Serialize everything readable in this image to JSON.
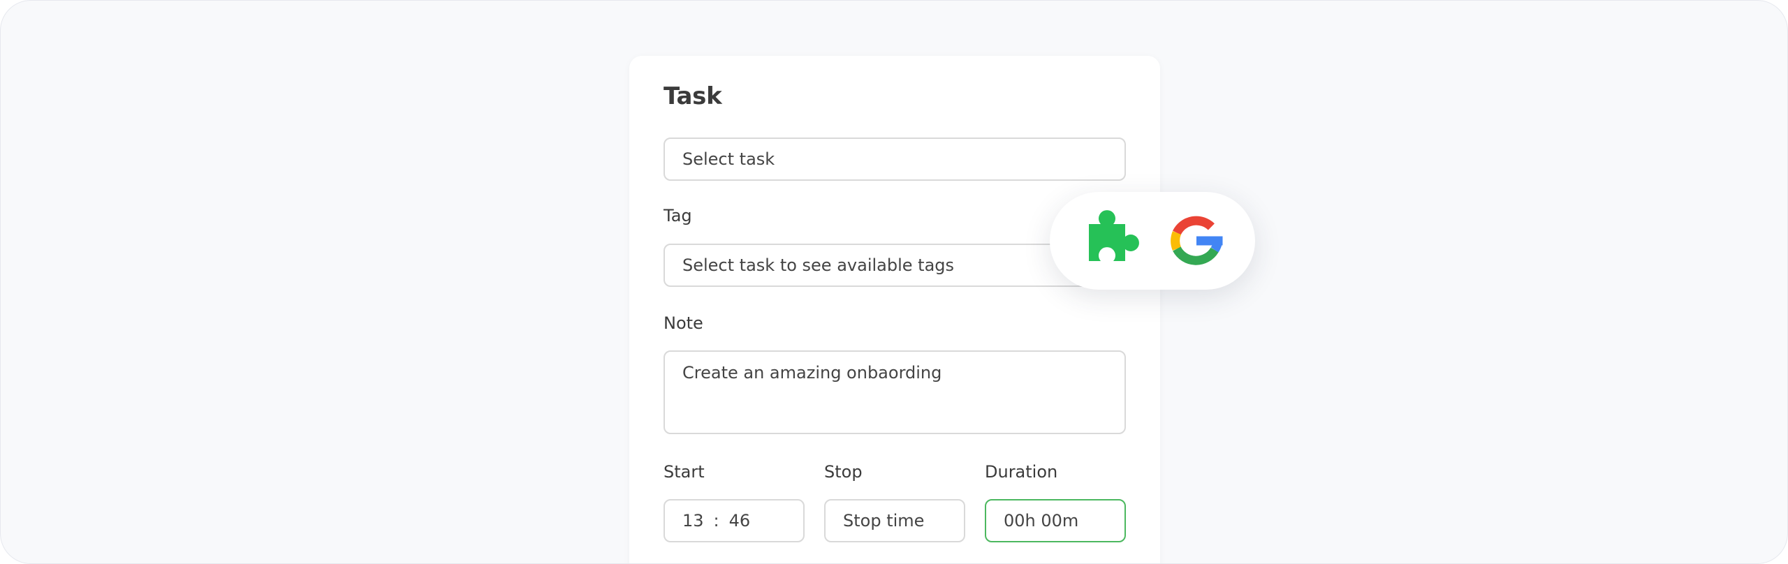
{
  "task": {
    "title": "Task",
    "select_placeholder": "Select task"
  },
  "tag": {
    "label": "Tag",
    "placeholder": "Select task to see available tags"
  },
  "note": {
    "label": "Note",
    "value": "Create an amazing onbaording"
  },
  "time": {
    "start_label": "Start",
    "start_hours": "13",
    "start_separator": ":",
    "start_minutes": "46",
    "stop_label": "Stop",
    "stop_placeholder": "Stop time",
    "duration_label": "Duration",
    "duration_value": "00h 00m"
  },
  "integrations": {
    "icons": [
      "puzzle-extension-icon",
      "google-icon"
    ]
  },
  "colors": {
    "puzzle_green": "#26c157",
    "active_border": "#4cb85f",
    "google_red": "#ea4335",
    "google_blue": "#4285f4",
    "google_green": "#34a853",
    "google_yellow": "#fbbc05"
  }
}
